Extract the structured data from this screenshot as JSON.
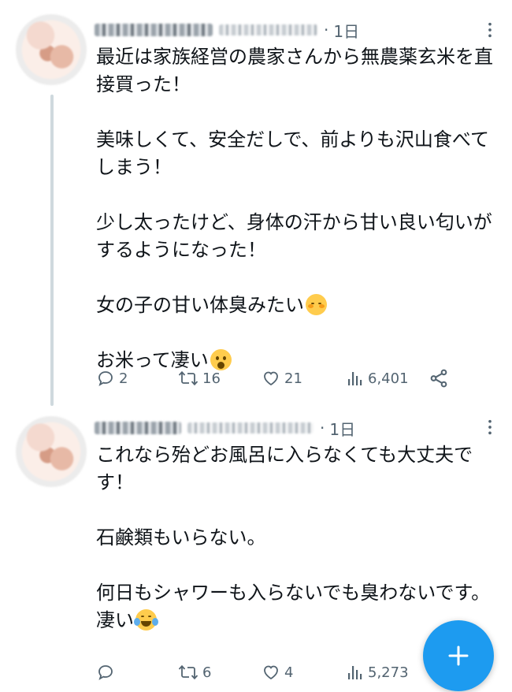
{
  "tweets": [
    {
      "time": "1日",
      "body": "最近は家族経営の農家さんから無農薬玄米を直接買った！\n\n美味しくて、安全だしで、前よりも沢山食べてしまう！\n\n少し太ったけど、身体の汗から甘い良い匂いがするようになった！\n\n女の子の甘い体臭みたい",
      "body_tail": "\n\nお米って凄い",
      "replies": "2",
      "retweets": "16",
      "likes": "21",
      "views": "6,401"
    },
    {
      "time": "1日",
      "body": "これなら殆どお風呂に入らなくても大丈夫です！\n\n石鹸類もいらない。\n\n何日もシャワーも入らないでも臭わないです。\n凄い",
      "replies": "",
      "retweets": "6",
      "likes": "4",
      "views": "5,273"
    }
  ],
  "colors": {
    "accent": "#1d9bf0",
    "text": "#0f1419",
    "secondary": "#536471",
    "thread_line": "#cfd9de"
  },
  "icons": {
    "more": "more-dots-icon",
    "reply": "reply-icon",
    "retweet": "retweet-icon",
    "like": "heart-icon",
    "views": "bar-chart-icon",
    "share": "share-icon",
    "compose": "plus-icon"
  }
}
